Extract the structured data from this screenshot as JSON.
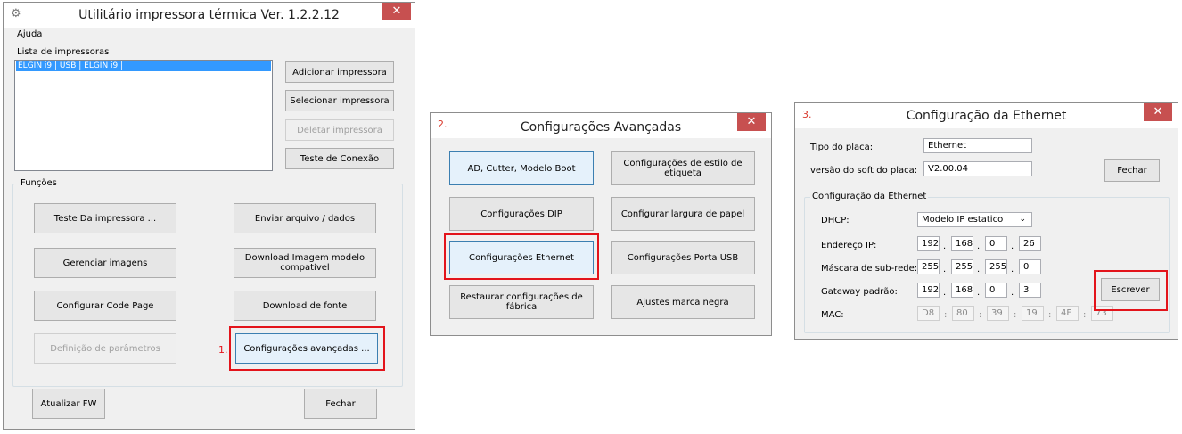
{
  "win1": {
    "title": "Utilitário impressora térmica Ver. 1.2.2.12",
    "close": "✕",
    "menu": "Ajuda",
    "printers_label": "Lista de impressoras",
    "printer_item": "ELGIN i9 | USB | ELGIN i9 |",
    "add": "Adicionar impressora",
    "select": "Selecionar impressora",
    "delete": "Deletar impressora",
    "test_conn": "Teste de Conexão",
    "functions_label": "Funções",
    "test_print": "Teste Da impressora ...",
    "send_file": "Enviar arquivo / dados",
    "manage_images": "Gerenciar imagens",
    "download_image": "Download Imagem modelo compatível",
    "code_page": "Configurar Code Page",
    "download_font": "Download de fonte",
    "params": "Definição de parâmetros",
    "advanced": "Configurações avançadas ...",
    "step": "1.",
    "update_fw": "Atualizar FW",
    "close_btn": "Fechar"
  },
  "win2": {
    "step": "2.",
    "title": "Configurações Avançadas",
    "close": "✕",
    "ad_cutter": "AD, Cutter, Modelo Boot",
    "label_style": "Configurações de estilo de etiqueta",
    "dip": "Configurações DIP",
    "paper_width": "Configurar largura de papel",
    "ethernet": "Configurações Ethernet",
    "usb": "Configurações Porta USB",
    "restore": "Restaurar configurações de fábrica",
    "black_mark": "Ajustes marca negra"
  },
  "win3": {
    "step": "3.",
    "title": "Configuração da Ethernet",
    "close": "✕",
    "board_type_label": "Tipo do placa:",
    "board_type_value": "Ethernet",
    "soft_version_label": "versão do soft do placa:",
    "soft_version_value": "V2.00.04",
    "close_btn": "Fechar",
    "group_label": "Configuração da Ethernet",
    "dhcp_label": "DHCP:",
    "dhcp_value": "Modelo IP estatico",
    "chevron": "⌄",
    "ip_label": "Endereço IP:",
    "ip": [
      "192",
      "168",
      "0",
      "26"
    ],
    "mask_label": "Máscara de sub-rede:",
    "mask": [
      "255",
      "255",
      "255",
      "0"
    ],
    "gateway_label": "Gateway padrão:",
    "gateway": [
      "192",
      "168",
      "0",
      "3"
    ],
    "mac_label": "MAC:",
    "mac": [
      "D8",
      "80",
      "39",
      "19",
      "4F",
      "73"
    ],
    "dot": ".",
    "colon": ":",
    "write": "Escrever"
  },
  "colors": {
    "highlight": "#e3141b",
    "close_bg": "#c75050",
    "selection": "#3399ff"
  }
}
